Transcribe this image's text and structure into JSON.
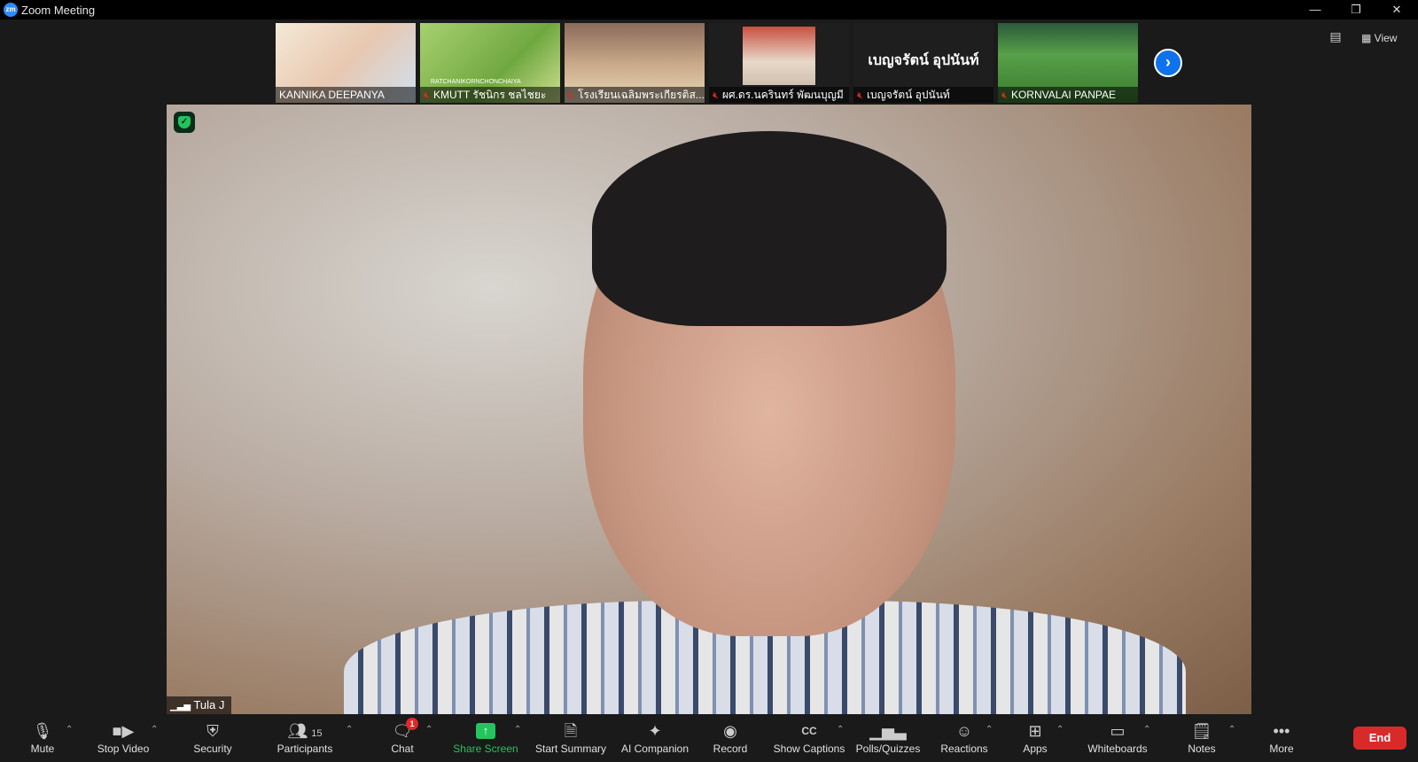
{
  "window": {
    "app_icon": "zm",
    "title": "Zoom Meeting",
    "minimize_icon": "minimize-icon",
    "restore_icon": "restore-icon",
    "close_icon": "close-icon"
  },
  "gallery": {
    "thumbnails": [
      {
        "name": "KANNIKA DEEPANYA",
        "muted": false
      },
      {
        "name": "KMUTT รัชนิกร ชลไชยะ",
        "muted": true,
        "overlay": "RATCHANIKORNCHONCHAIYA"
      },
      {
        "name": "โรงเรียนเฉลิมพระเกียรติส...",
        "muted": true
      },
      {
        "name": "ผศ.ดร.นครินทร์ พัฒนบุญมี",
        "muted": true
      },
      {
        "name": "เบญจรัตน์ อุปนันท์",
        "muted": true,
        "large_name": "เบญจรัตน์ อุปนันท์"
      },
      {
        "name": "KORNVALAI PANPAE",
        "muted": true
      }
    ],
    "next_button": "›"
  },
  "top_right": {
    "view_label": "View"
  },
  "main_video": {
    "speaker": "Tula J"
  },
  "toolbar": {
    "mute": "Mute",
    "stop_video": "Stop Video",
    "security": "Security",
    "participants": "Participants",
    "participants_count": "15",
    "chat": "Chat",
    "chat_badge": "1",
    "share_screen": "Share Screen",
    "start_summary": "Start Summary",
    "ai_companion": "AI Companion",
    "record": "Record",
    "show_captions": "Show Captions",
    "polls": "Polls/Quizzes",
    "reactions": "Reactions",
    "apps": "Apps",
    "whiteboards": "Whiteboards",
    "notes": "Notes",
    "more": "More",
    "end": "End"
  },
  "colors": {
    "accent_blue": "#0e72ed",
    "share_green": "#23c45e",
    "end_red": "#d92a2a",
    "muted_red": "#e02828"
  }
}
